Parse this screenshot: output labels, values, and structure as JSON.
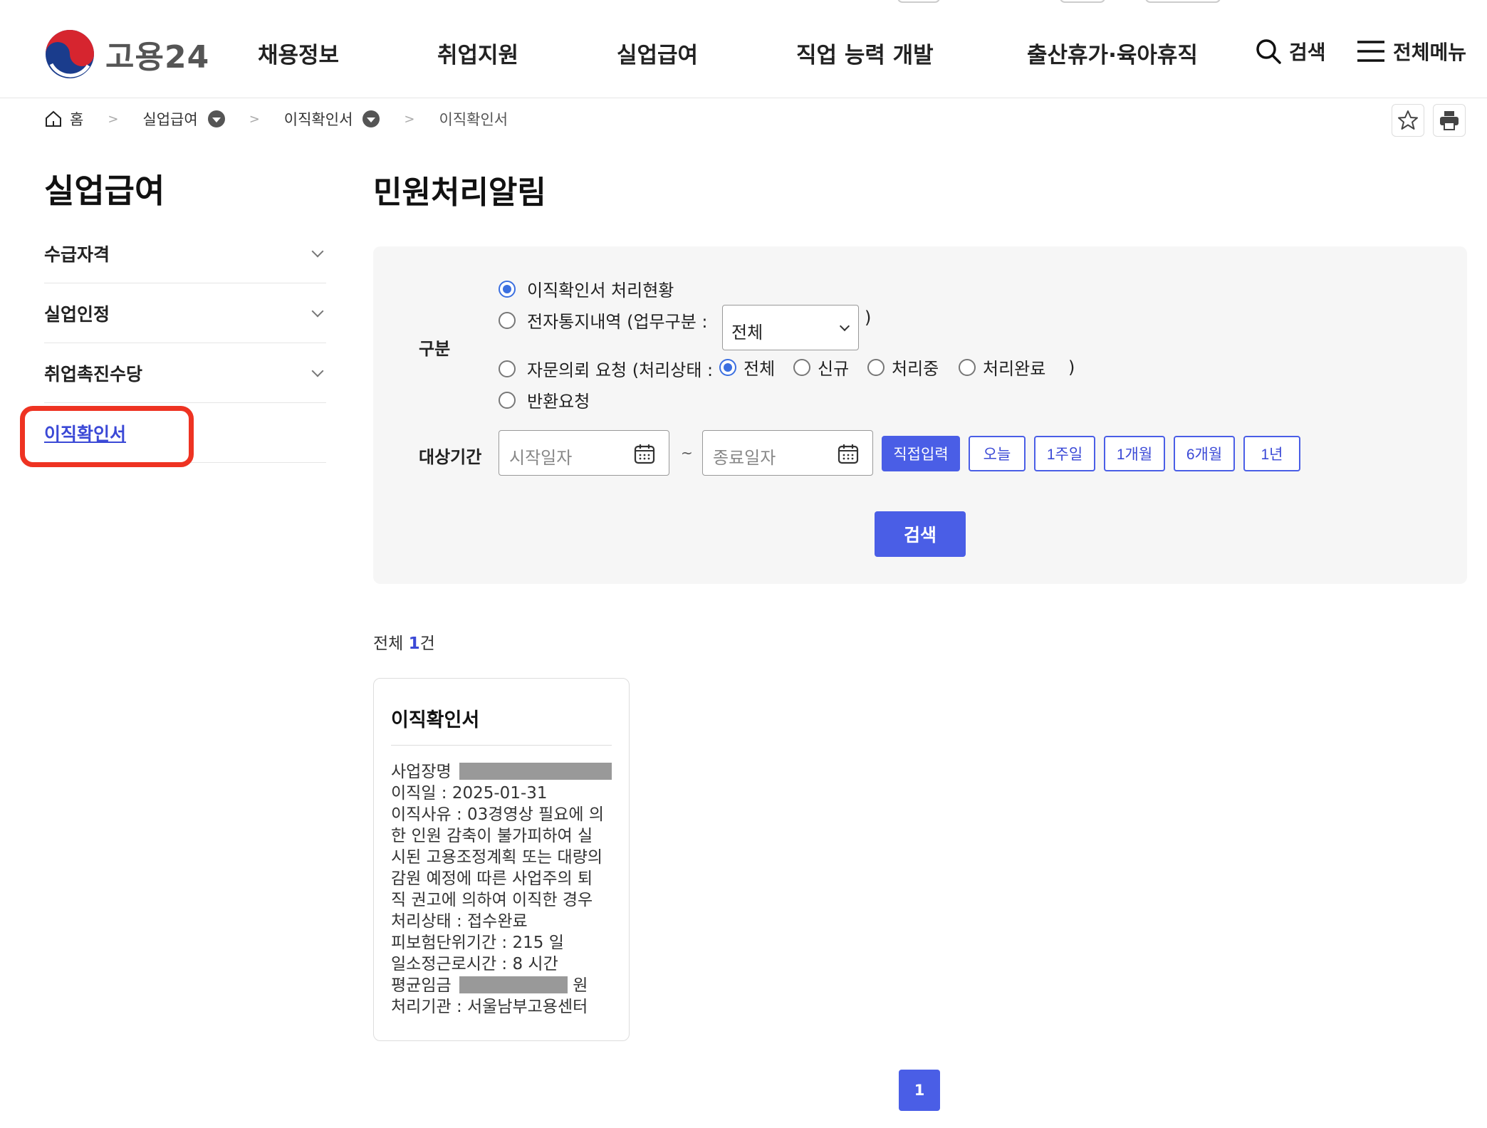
{
  "brand": {
    "name": "고용24"
  },
  "gnb": [
    "채용정보",
    "취업지원",
    "실업급여",
    "직업 능력 개발",
    "출산휴가·육아휴직"
  ],
  "util": {
    "search": "검색",
    "menu": "전체메뉴"
  },
  "breadcrumb": {
    "home": "홈",
    "level1": "실업급여",
    "level2": "이직확인서",
    "current": "이직확인서"
  },
  "sidebar": {
    "title": "실업급여",
    "items": [
      {
        "label": "수급자격"
      },
      {
        "label": "실업인정"
      },
      {
        "label": "취업촉진수당"
      },
      {
        "label": "이직확인서"
      }
    ]
  },
  "main": {
    "title": "민원처리알림",
    "form": {
      "type_label": "구분",
      "opt1": "이직확인서 처리현황",
      "opt2_prefix": "전자통지내역 (업무구분 :",
      "opt2_select": "전체",
      "opt2_suffix": ")",
      "opt3_prefix": "자문의뢰 요청 (처리상태 :",
      "opt3_sub": [
        "전체",
        "신규",
        "처리중",
        "처리완료"
      ],
      "opt3_suffix": ")",
      "opt4": "반환요청",
      "period_label": "대상기간",
      "start_placeholder": "시작일자",
      "end_placeholder": "종료일자",
      "tilde": "~",
      "period_buttons": [
        "직접입력",
        "오늘",
        "1주일",
        "1개월",
        "6개월",
        "1년"
      ],
      "search_button": "검색"
    },
    "total": {
      "prefix": "전체",
      "count": "1",
      "suffix": "건"
    },
    "card": {
      "title": "이직확인서",
      "workplace_label": "사업장명",
      "leave_date": "이직일 : 2025-01-31",
      "reason_lines": [
        "이직사유 : 03경영상 필요에 의",
        "한 인원 감축이 불가피하여 실",
        "시된 고용조정계획 또는 대량의",
        "감원 예정에 따른 사업주의 퇴",
        "직 권고에 의하여 이직한 경우"
      ],
      "status": "처리상태 : 접수완료",
      "insured_period": "피보험단위기간 : 215 일",
      "work_hours": "일소정근로시간 : 8 시간",
      "wage_label": "평균임금",
      "wage_unit": "원",
      "office": "처리기관 : 서울남부고용센터"
    },
    "pagination": {
      "current": "1"
    }
  },
  "colors": {
    "accent": "#4a5ee6",
    "highlight": "#ee3322",
    "panel": "#f6f6f6"
  }
}
